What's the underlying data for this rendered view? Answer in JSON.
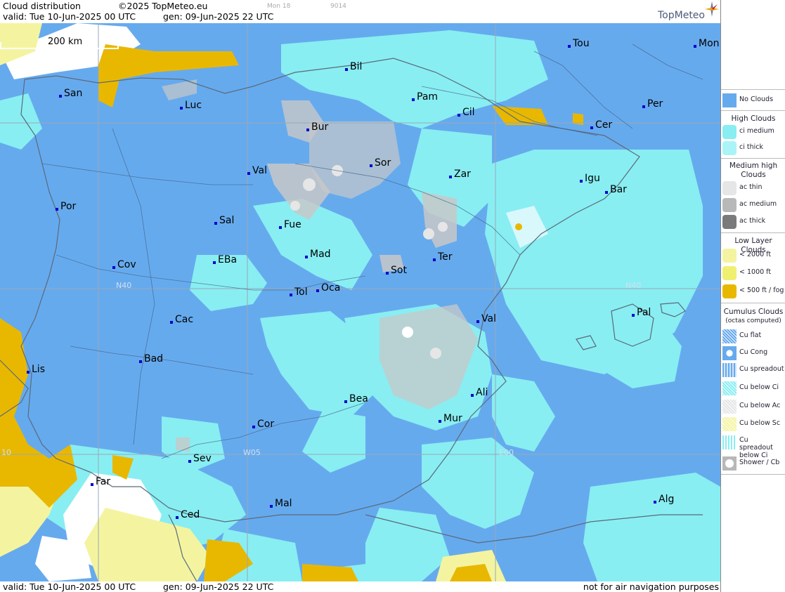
{
  "header": {
    "title": "Cloud distribution",
    "copyright": "©2025 TopMeteo.eu",
    "faint_a": "Mon 18",
    "faint_b": "9014",
    "valid": "valid:  Tue  10-Jun-2025  00 UTC",
    "gen": "gen: 09-Jun-2025 22 UTC",
    "logo": "TopMeteo"
  },
  "footer": {
    "valid": "valid:  Tue  10-Jun-2025  00 UTC",
    "gen": "gen: 09-Jun-2025 22 UTC",
    "disclaimer": "not for air navigation purposes"
  },
  "map": {
    "scale_label": "200 km",
    "grid_labels": {
      "n40_left": "N40",
      "n40_right": "N40",
      "w05": "W05",
      "e00": "E00",
      "w10": "10"
    },
    "cities": [
      {
        "name": "Tou"
      },
      {
        "name": "Mon"
      },
      {
        "name": "Bil"
      },
      {
        "name": "San"
      },
      {
        "name": "Pam"
      },
      {
        "name": "Luc"
      },
      {
        "name": "Cil"
      },
      {
        "name": "Per"
      },
      {
        "name": "Bur"
      },
      {
        "name": "Cer"
      },
      {
        "name": "Sor"
      },
      {
        "name": "Val"
      },
      {
        "name": "Zar"
      },
      {
        "name": "Igu"
      },
      {
        "name": "Bar"
      },
      {
        "name": "Por"
      },
      {
        "name": "Sal"
      },
      {
        "name": "Fue"
      },
      {
        "name": "Mad"
      },
      {
        "name": "Ter"
      },
      {
        "name": "Cov"
      },
      {
        "name": "EBa"
      },
      {
        "name": "Sot"
      },
      {
        "name": "Tol"
      },
      {
        "name": "Oca"
      },
      {
        "name": "Pal"
      },
      {
        "name": "Val"
      },
      {
        "name": "Cac"
      },
      {
        "name": "Bad"
      },
      {
        "name": "Lis"
      },
      {
        "name": "Ali"
      },
      {
        "name": "Bea"
      },
      {
        "name": "Mur"
      },
      {
        "name": "Cor"
      },
      {
        "name": "Sev"
      },
      {
        "name": "Far"
      },
      {
        "name": "Mal"
      },
      {
        "name": "Alg"
      },
      {
        "name": "Ced"
      }
    ]
  },
  "legend": {
    "no_clouds": "No Clouds",
    "high_clouds": "High Clouds",
    "ci_medium": "ci medium",
    "ci_thick": "ci thick",
    "medium_high": "Medium high Clouds",
    "ac_thin": "ac thin",
    "ac_medium": "ac medium",
    "ac_thick": "ac thick",
    "low_layer": "Low Layer Clouds",
    "lt2000": "< 2000 ft",
    "lt1000": "< 1000 ft",
    "lt500": "< 500 ft / fog",
    "cumulus": "Cumulus Clouds",
    "octas": "(octas computed)",
    "cu_flat": "Cu flat",
    "cu_cong": "Cu Cong",
    "cu_spreadout": "Cu spreadout",
    "cu_below_ci": "Cu below Ci",
    "cu_below_ac": "Cu below Ac",
    "cu_below_sc": "Cu below Sc",
    "cu_spreadout_below_ci": "Cu spreadout below Ci",
    "shower_cb": "Shower / Cb"
  },
  "colors": {
    "no_clouds": "#66aaee",
    "ci_medium": "#88eef2",
    "ci_thick": "#aaf4f8",
    "low_2000": "#f4f4a0",
    "low_1000": "#f0f070",
    "low_500": "#e8b800",
    "ac": "#c8c8c8"
  }
}
